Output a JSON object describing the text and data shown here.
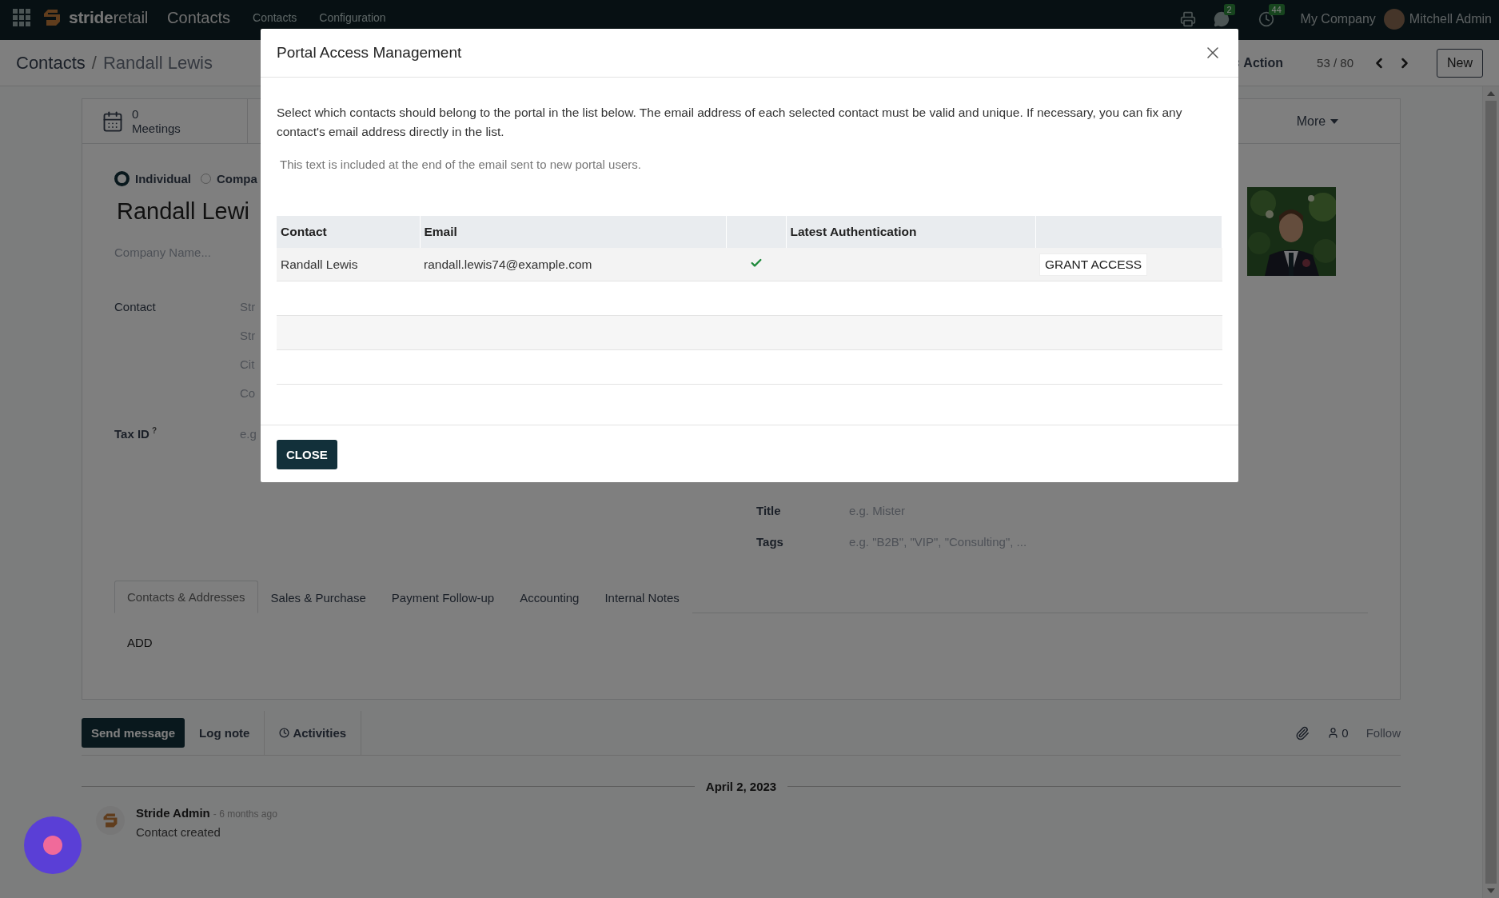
{
  "topbar": {
    "brand_bold": "stride",
    "brand_light": "retail",
    "app_name": "Contacts",
    "menu": [
      "Contacts",
      "Configuration"
    ],
    "messages_count": "2",
    "activities_count": "44",
    "company": "My Company",
    "user": "Mitchell Admin"
  },
  "breadcrumb": {
    "parent": "Contacts",
    "separator": "/",
    "current": "Randall Lewis"
  },
  "control_panel": {
    "action": "Action",
    "pager": "53 / 80",
    "new_button": "New"
  },
  "smart_buttons": [
    {
      "count": "0",
      "label": "Meetings"
    }
  ],
  "more": "More",
  "form": {
    "company_types": [
      {
        "label": "Individual",
        "selected": true
      },
      {
        "label": "Compa",
        "selected": false
      }
    ],
    "name": "Randall Lewi",
    "company_placeholder": "Company Name...",
    "address_label": "Contact",
    "address_lines": [
      "Str",
      "Str",
      "Cit",
      "Co"
    ],
    "tax_id_label": "Tax ID",
    "tax_id_help": "?",
    "tax_id_placeholder": "e.g",
    "right_fields": [
      {
        "label": "Title",
        "placeholder": "e.g. Mister"
      },
      {
        "label": "Tags",
        "placeholder": "e.g. \"B2B\", \"VIP\", \"Consulting\", ..."
      }
    ],
    "photo": {
      "kind": "picture"
    }
  },
  "notebook": {
    "tabs": [
      {
        "label": "Contacts & Addresses",
        "selected": true
      },
      {
        "label": "Sales & Purchase",
        "selected": false
      },
      {
        "label": "Payment Follow-up",
        "selected": false
      },
      {
        "label": "Accounting",
        "selected": false
      },
      {
        "label": "Internal Notes",
        "selected": false
      }
    ],
    "add": "ADD"
  },
  "chatter": {
    "send_message": "Send message",
    "log_note": "Log note",
    "activities": "Activities",
    "followers": "0",
    "follow": "Follow",
    "date": "April 2, 2023",
    "messages": [
      {
        "author": "Stride Admin",
        "time": "- 6 months ago",
        "body": "Contact created"
      }
    ]
  },
  "modal": {
    "title": "Portal Access Management",
    "description": "Select which contacts should belong to the portal in the list below. The email address of each selected contact must be valid and unique. If necessary, you can fix any contact's email address directly in the list.",
    "note_placeholder": "This text is included at the end of the email sent to new portal users.",
    "columns": [
      {
        "label": "Contact"
      },
      {
        "label": "Email"
      },
      {},
      {
        "label": "Latest Authentication"
      },
      {}
    ],
    "rows": [
      {
        "contact": "Randall Lewis",
        "email": "randall.lewis74@example.com",
        "in_portal": true,
        "action": "GRANT ACCESS"
      }
    ],
    "close_button": "CLOSE"
  }
}
